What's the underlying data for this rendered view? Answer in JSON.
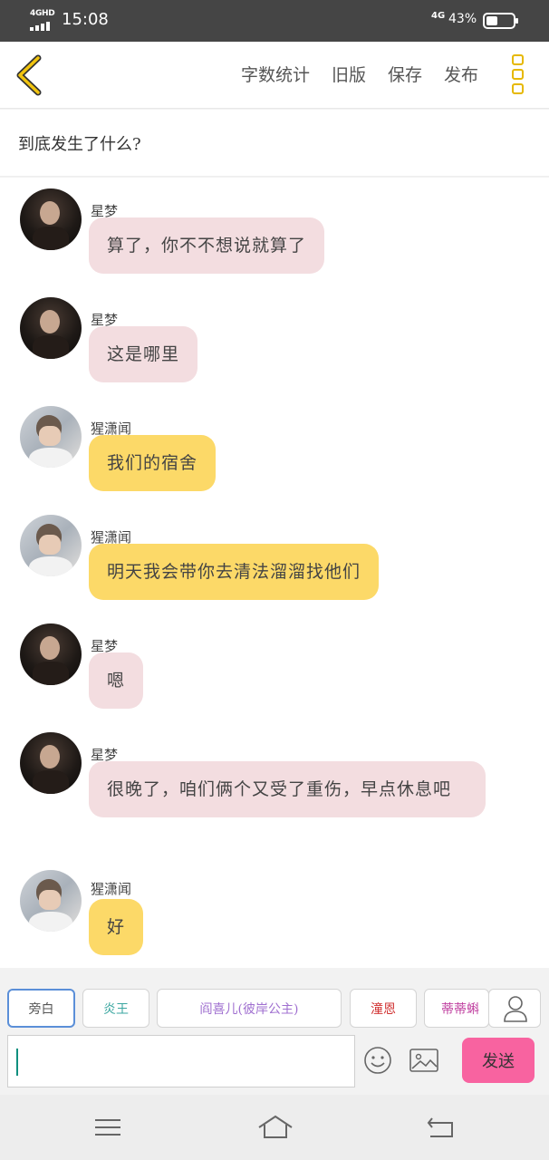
{
  "status_bar": {
    "network": "4GHD",
    "time": "15:08",
    "mobile_data": "4G",
    "battery_percent": "43%",
    "battery_level": 0.43
  },
  "header": {
    "back_icon": "chevron-left-icon",
    "actions": [
      "字数统计",
      "旧版",
      "保存",
      "发布"
    ],
    "more_icon": "three-squares-menu-icon",
    "accent_color": "#e6b800"
  },
  "topic": {
    "text": "到底发生了什么?"
  },
  "messages": [
    {
      "name": "星梦",
      "text": "算了，你不不想说就算了",
      "style": "pink"
    },
    {
      "name": "星梦",
      "text": "这是哪里",
      "style": "pink"
    },
    {
      "name": "猩潇闻",
      "text": "我们的宿舍",
      "style": "yellow"
    },
    {
      "name": "猩潇闻",
      "text": "明天我会带你去清法溜溜找他们",
      "style": "yellow"
    },
    {
      "name": "星梦",
      "text": "嗯",
      "style": "pink"
    },
    {
      "name": "星梦",
      "text": "很晚了，咱们俩个又受了重伤，早点休息吧",
      "style": "pink"
    },
    {
      "name": "猩潇闻",
      "text": "好",
      "style": "yellow"
    }
  ],
  "roles": {
    "chips": [
      {
        "label": "旁白",
        "color": "#555555",
        "active": true
      },
      {
        "label": "炎王",
        "color": "#3aa6a0",
        "active": false
      },
      {
        "label": "阎喜儿(彼岸公主)",
        "color": "#a070d0",
        "active": false
      },
      {
        "label": "潼恩",
        "color": "#d03030",
        "active": false
      },
      {
        "label": "蒂蒂蝌",
        "color": "#c040a0",
        "active": false
      }
    ],
    "add_person_icon": "person-icon"
  },
  "input": {
    "value": "",
    "emoji_icon": "smiley-icon",
    "image_icon": "image-icon",
    "send_label": "发送",
    "send_color": "#f863a0"
  },
  "navbar": {
    "menu_icon": "menu-icon",
    "home_icon": "home-icon",
    "back_icon": "back-arrow-icon"
  }
}
